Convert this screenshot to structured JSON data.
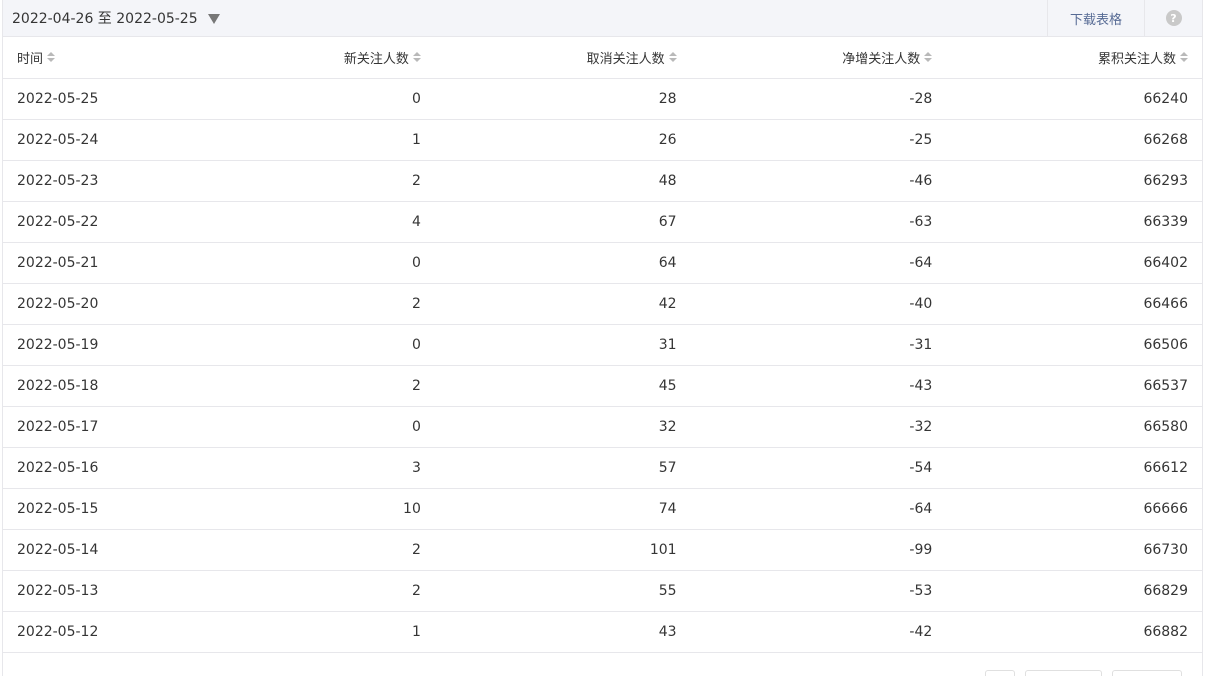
{
  "toolbar": {
    "date_range": "2022-04-26 至 2022-05-25",
    "download_label": "下载表格",
    "help_icon": "?"
  },
  "table": {
    "columns": [
      "时间",
      "新关注人数",
      "取消关注人数",
      "净增关注人数",
      "累积关注人数"
    ],
    "rows": [
      [
        "2022-05-25",
        "0",
        "28",
        "-28",
        "66240"
      ],
      [
        "2022-05-24",
        "1",
        "26",
        "-25",
        "66268"
      ],
      [
        "2022-05-23",
        "2",
        "48",
        "-46",
        "66293"
      ],
      [
        "2022-05-22",
        "4",
        "67",
        "-63",
        "66339"
      ],
      [
        "2022-05-21",
        "0",
        "64",
        "-64",
        "66402"
      ],
      [
        "2022-05-20",
        "2",
        "42",
        "-40",
        "66466"
      ],
      [
        "2022-05-19",
        "0",
        "31",
        "-31",
        "66506"
      ],
      [
        "2022-05-18",
        "2",
        "45",
        "-43",
        "66537"
      ],
      [
        "2022-05-17",
        "0",
        "32",
        "-32",
        "66580"
      ],
      [
        "2022-05-16",
        "3",
        "57",
        "-54",
        "66612"
      ],
      [
        "2022-05-15",
        "10",
        "74",
        "-64",
        "66666"
      ],
      [
        "2022-05-14",
        "2",
        "101",
        "-99",
        "66730"
      ],
      [
        "2022-05-13",
        "2",
        "55",
        "-53",
        "66829"
      ],
      [
        "2022-05-12",
        "1",
        "43",
        "-42",
        "66882"
      ]
    ]
  },
  "colors": {
    "link": "#576b95",
    "border": "#e7e7eb",
    "toolbar_bg": "#f4f5f9"
  }
}
